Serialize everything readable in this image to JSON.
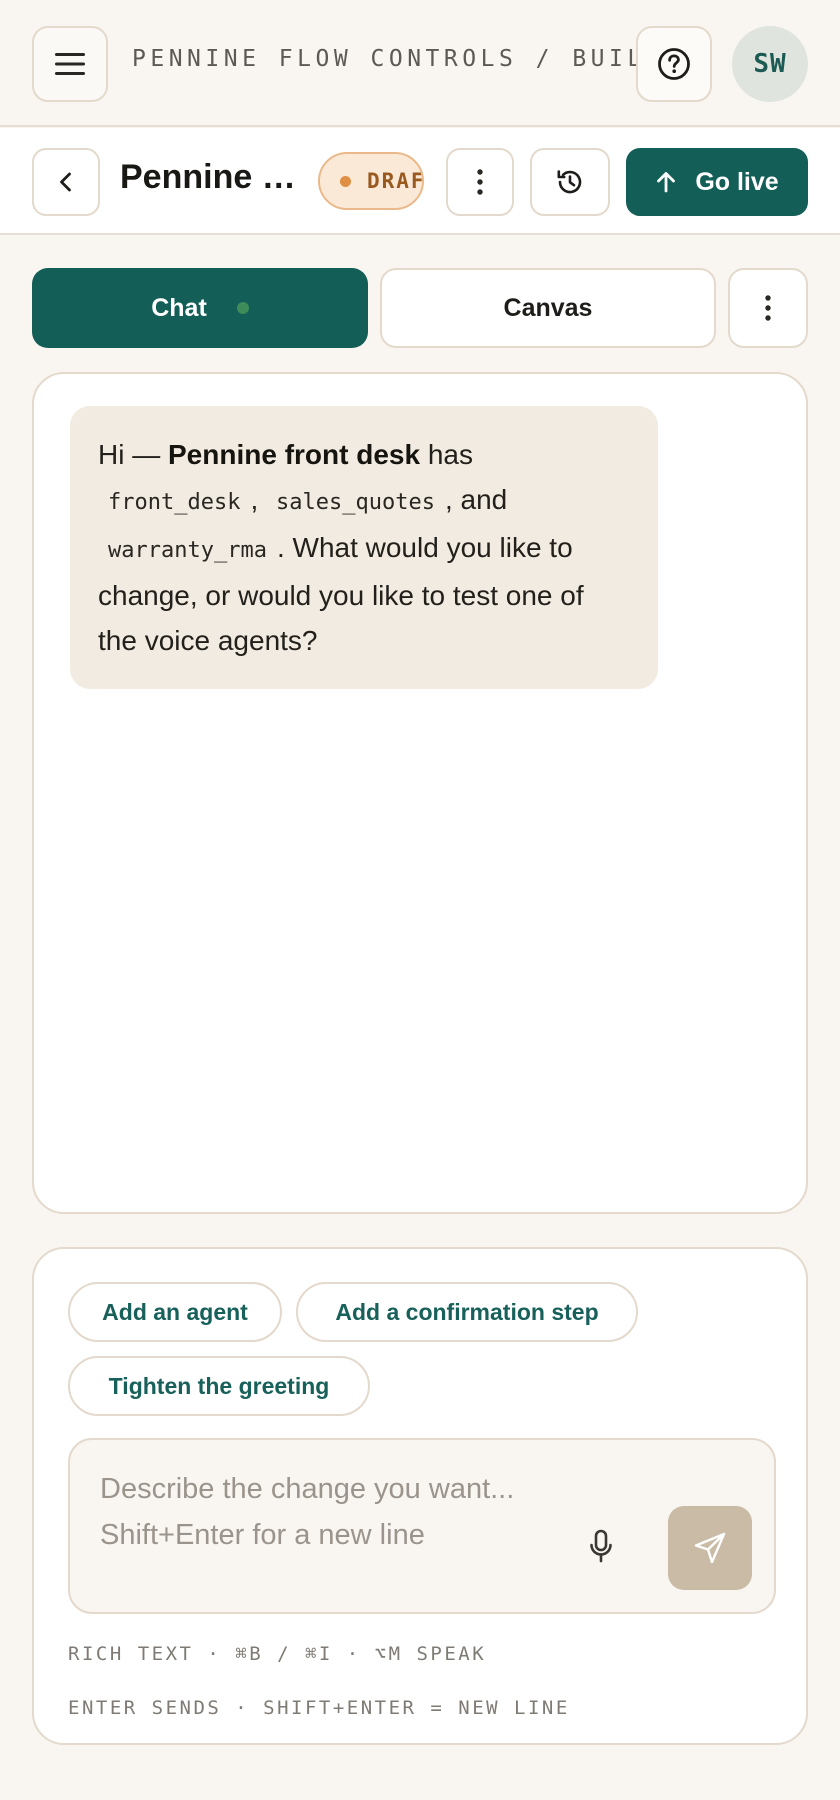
{
  "topbar": {
    "breadcrumb": "PENNINE FLOW CONTROLS / BUILD",
    "avatar_initials": "SW",
    "icons": [
      "hamburger-menu-icon",
      "help-circle-icon"
    ]
  },
  "flow": {
    "title": "Pennine front desk",
    "status": "DRAFT",
    "go_live_label": "Go live",
    "icons": [
      "chevron-left-icon",
      "kebab-icon",
      "history-icon",
      "arrow-up-icon"
    ]
  },
  "tabs": [
    {
      "label": "Chat",
      "active": true
    },
    {
      "label": "Canvas",
      "active": false
    }
  ],
  "chat": {
    "messages": [
      {
        "role": "assistant",
        "greeting": "Hi — ",
        "flow_name": "Pennine front desk",
        "has": " has",
        "agents": [
          "front_desk",
          "sales_quotes",
          "warranty_rma"
        ],
        "sep_1": ",",
        "sep_2": ", and",
        "question": ". What would you like to change, or would you like to test one of the voice agents?"
      }
    ]
  },
  "composer": {
    "suggestions": [
      "Add an agent",
      "Add a confirmation step",
      "Tighten the greeting"
    ],
    "placeholder_line_1": "Describe the change you want...",
    "placeholder_line_2": "Shift+Enter for a new line",
    "hint_1": "RICH TEXT · ⌘B / ⌘I · ⌥M SPEAK",
    "hint_2": "ENTER SENDS · SHIFT+ENTER = NEW LINE",
    "icons": [
      "microphone-icon",
      "send-icon"
    ]
  },
  "colors": {
    "accent": "#135e57",
    "background": "#f9f6f1",
    "draft_badge": "#fbe9d8",
    "assistant_bubble": "#f1ebe1",
    "send_disabled": "#c9bba6"
  }
}
